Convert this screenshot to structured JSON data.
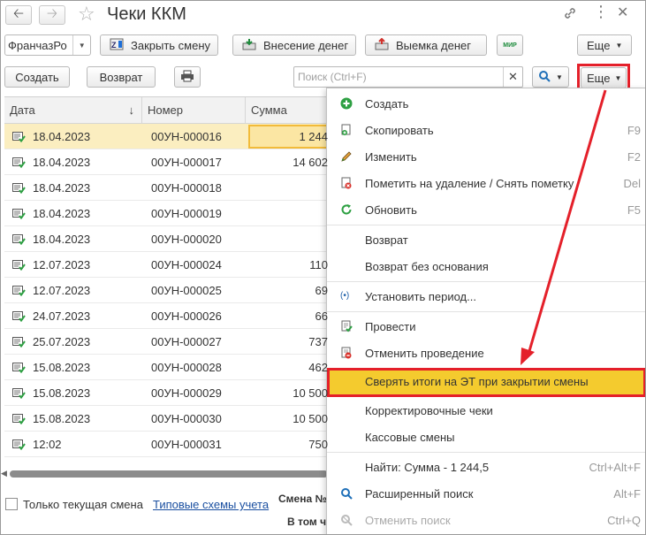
{
  "window": {
    "title": "Чеки ККМ",
    "nav_back_icon": "arrow-left-icon",
    "nav_forward_icon": "arrow-right-icon"
  },
  "toolbar1": {
    "organization_value": "ФранчазРо",
    "close_shift": "Закрыть смену",
    "cash_in": "Внесение денег",
    "cash_out": "Выемка денег",
    "mir_label": "МИР",
    "more": "Еще"
  },
  "toolbar2": {
    "create": "Создать",
    "return": "Возврат",
    "search_placeholder": "Поиск (Ctrl+F)",
    "more": "Еще"
  },
  "table": {
    "columns": [
      "Дата",
      "Номер",
      "Сумма"
    ],
    "sort_indicator": "↓",
    "rows": [
      {
        "date": "18.04.2023",
        "number": "00УН-000016",
        "sum": "1 244",
        "selected": true
      },
      {
        "date": "18.04.2023",
        "number": "00УН-000017",
        "sum": "14 602"
      },
      {
        "date": "18.04.2023",
        "number": "00УН-000018",
        "sum": ""
      },
      {
        "date": "18.04.2023",
        "number": "00УН-000019",
        "sum": ""
      },
      {
        "date": "18.04.2023",
        "number": "00УН-000020",
        "sum": ""
      },
      {
        "date": "12.07.2023",
        "number": "00УН-000024",
        "sum": "110"
      },
      {
        "date": "12.07.2023",
        "number": "00УН-000025",
        "sum": "69"
      },
      {
        "date": "24.07.2023",
        "number": "00УН-000026",
        "sum": "66"
      },
      {
        "date": "25.07.2023",
        "number": "00УН-000027",
        "sum": "737"
      },
      {
        "date": "15.08.2023",
        "number": "00УН-000028",
        "sum": "462"
      },
      {
        "date": "15.08.2023",
        "number": "00УН-000029",
        "sum": "10 500"
      },
      {
        "date": "15.08.2023",
        "number": "00УН-000030",
        "sum": "10 500"
      },
      {
        "date": "12:02",
        "number": "00УН-000031",
        "sum": "750"
      }
    ]
  },
  "footer": {
    "only_current_shift": "Только текущая смена",
    "accounting_schemes": "Типовые схемы учета",
    "shift_label": "Смена №",
    "in_that": "В том ч"
  },
  "menu": {
    "items": [
      {
        "label": "Создать",
        "shortcut": "",
        "icon": "plus-circle-icon"
      },
      {
        "label": "Скопировать",
        "shortcut": "F9",
        "icon": "copy-icon"
      },
      {
        "label": "Изменить",
        "shortcut": "F2",
        "icon": "pencil-icon"
      },
      {
        "label": "Пометить на удаление / Снять пометку",
        "shortcut": "Del",
        "icon": "delete-mark-icon"
      },
      {
        "label": "Обновить",
        "shortcut": "F5",
        "icon": "refresh-icon"
      },
      {
        "label": "Возврат",
        "shortcut": "",
        "icon": ""
      },
      {
        "label": "Возврат без основания",
        "shortcut": "",
        "icon": ""
      },
      {
        "label": "Установить период...",
        "shortcut": "",
        "icon": "period-icon"
      },
      {
        "label": "Провести",
        "shortcut": "",
        "icon": "post-document-icon"
      },
      {
        "label": "Отменить проведение",
        "shortcut": "",
        "icon": "unpost-document-icon"
      },
      {
        "label": "Сверять итоги на ЭТ при закрытии смены",
        "shortcut": "",
        "icon": ""
      },
      {
        "label": "Корректировочные чеки",
        "shortcut": "",
        "icon": ""
      },
      {
        "label": "Кассовые смены",
        "shortcut": "",
        "icon": ""
      },
      {
        "label": "Найти: Сумма - 1 244,5",
        "shortcut": "Ctrl+Alt+F",
        "icon": ""
      },
      {
        "label": "Расширенный поиск",
        "shortcut": "Alt+F",
        "icon": "search-icon"
      },
      {
        "label": "Отменить поиск",
        "shortcut": "Ctrl+Q",
        "icon": "cancel-search-icon"
      }
    ]
  },
  "colors": {
    "highlight_red": "#e4202a",
    "selected_row": "#fbeec0",
    "menu_highlight": "#f4cb2e",
    "link": "#1a4fa0"
  }
}
